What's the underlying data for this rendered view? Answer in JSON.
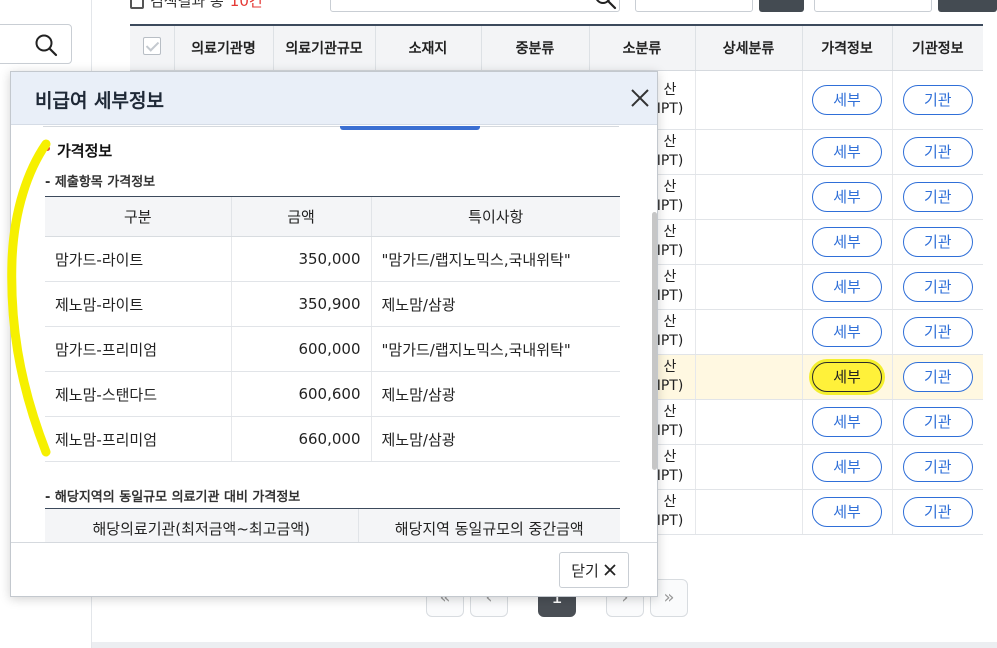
{
  "topbar": {
    "result_prefix": "검색결과 총",
    "result_count": "10건"
  },
  "results_table": {
    "headers": [
      "의료기관명",
      "의료기관규모",
      "소재지",
      "중분류",
      "소분류",
      "상세분류",
      "가격정보",
      "기관정보"
    ],
    "rows": [
      {
        "sub_line1": "산",
        "sub_line2": "IPT)",
        "detail": "세부",
        "org": "기관"
      },
      {
        "sub_line1": "산",
        "sub_line2": "IPT)",
        "detail": "세부",
        "org": "기관"
      },
      {
        "sub_line1": "산",
        "sub_line2": "IPT)",
        "detail": "세부",
        "org": "기관"
      },
      {
        "sub_line1": "산",
        "sub_line2": "IPT)",
        "detail": "세부",
        "org": "기관"
      },
      {
        "sub_line1": "산",
        "sub_line2": "IPT)",
        "detail": "세부",
        "org": "기관"
      },
      {
        "sub_line1": "산",
        "sub_line2": "IPT)",
        "detail": "세부",
        "org": "기관"
      },
      {
        "sub_line1": "산",
        "sub_line2": "IPT)",
        "detail": "세부",
        "org": "기관"
      },
      {
        "sub_line1": "산",
        "sub_line2": "IPT)",
        "detail": "세부",
        "org": "기관"
      },
      {
        "sub_line1": "산",
        "sub_line2": "IPT)",
        "detail": "세부",
        "org": "기관"
      },
      {
        "sub_line1": "산",
        "sub_line2": "IPT)",
        "detail": "세부",
        "org": "기관"
      }
    ]
  },
  "pagination": {
    "first": "«",
    "prev": "‹",
    "current": "1",
    "next": "›",
    "last": "»"
  },
  "modal": {
    "title": "비급여 세부정보",
    "section_title": "가격정보",
    "price_subtitle": "- 제출항목 가격정보",
    "price_headers": [
      "구분",
      "금액",
      "특이사항"
    ],
    "price_rows": [
      {
        "category": "맘가드-라이트",
        "amount": "350,000",
        "note": "\"맘가드/랩지노믹스,국내위탁\""
      },
      {
        "category": "제노맘-라이트",
        "amount": "350,900",
        "note": "제노맘/삼광"
      },
      {
        "category": "맘가드-프리미엄",
        "amount": "600,000",
        "note": "\"맘가드/랩지노믹스,국내위탁\""
      },
      {
        "category": "제노맘-스탠다드",
        "amount": "600,600",
        "note": "제노맘/삼광"
      },
      {
        "category": "제노맘-프리미엄",
        "amount": "660,000",
        "note": "제노맘/삼광"
      }
    ],
    "compare_subtitle": "- 해당지역의 동일규모 의료기관 대비 가격정보",
    "compare_headers": [
      "해당의료기관(최저금액~최고금액)",
      "해당지역 동일규모의 중간금액"
    ],
    "close_label": "닫기"
  },
  "colors": {
    "accent_blue": "#2f6fd8",
    "highlight_yellow": "#fff13a",
    "header_bg": "#e9eff8",
    "count_red": "#e53935"
  }
}
